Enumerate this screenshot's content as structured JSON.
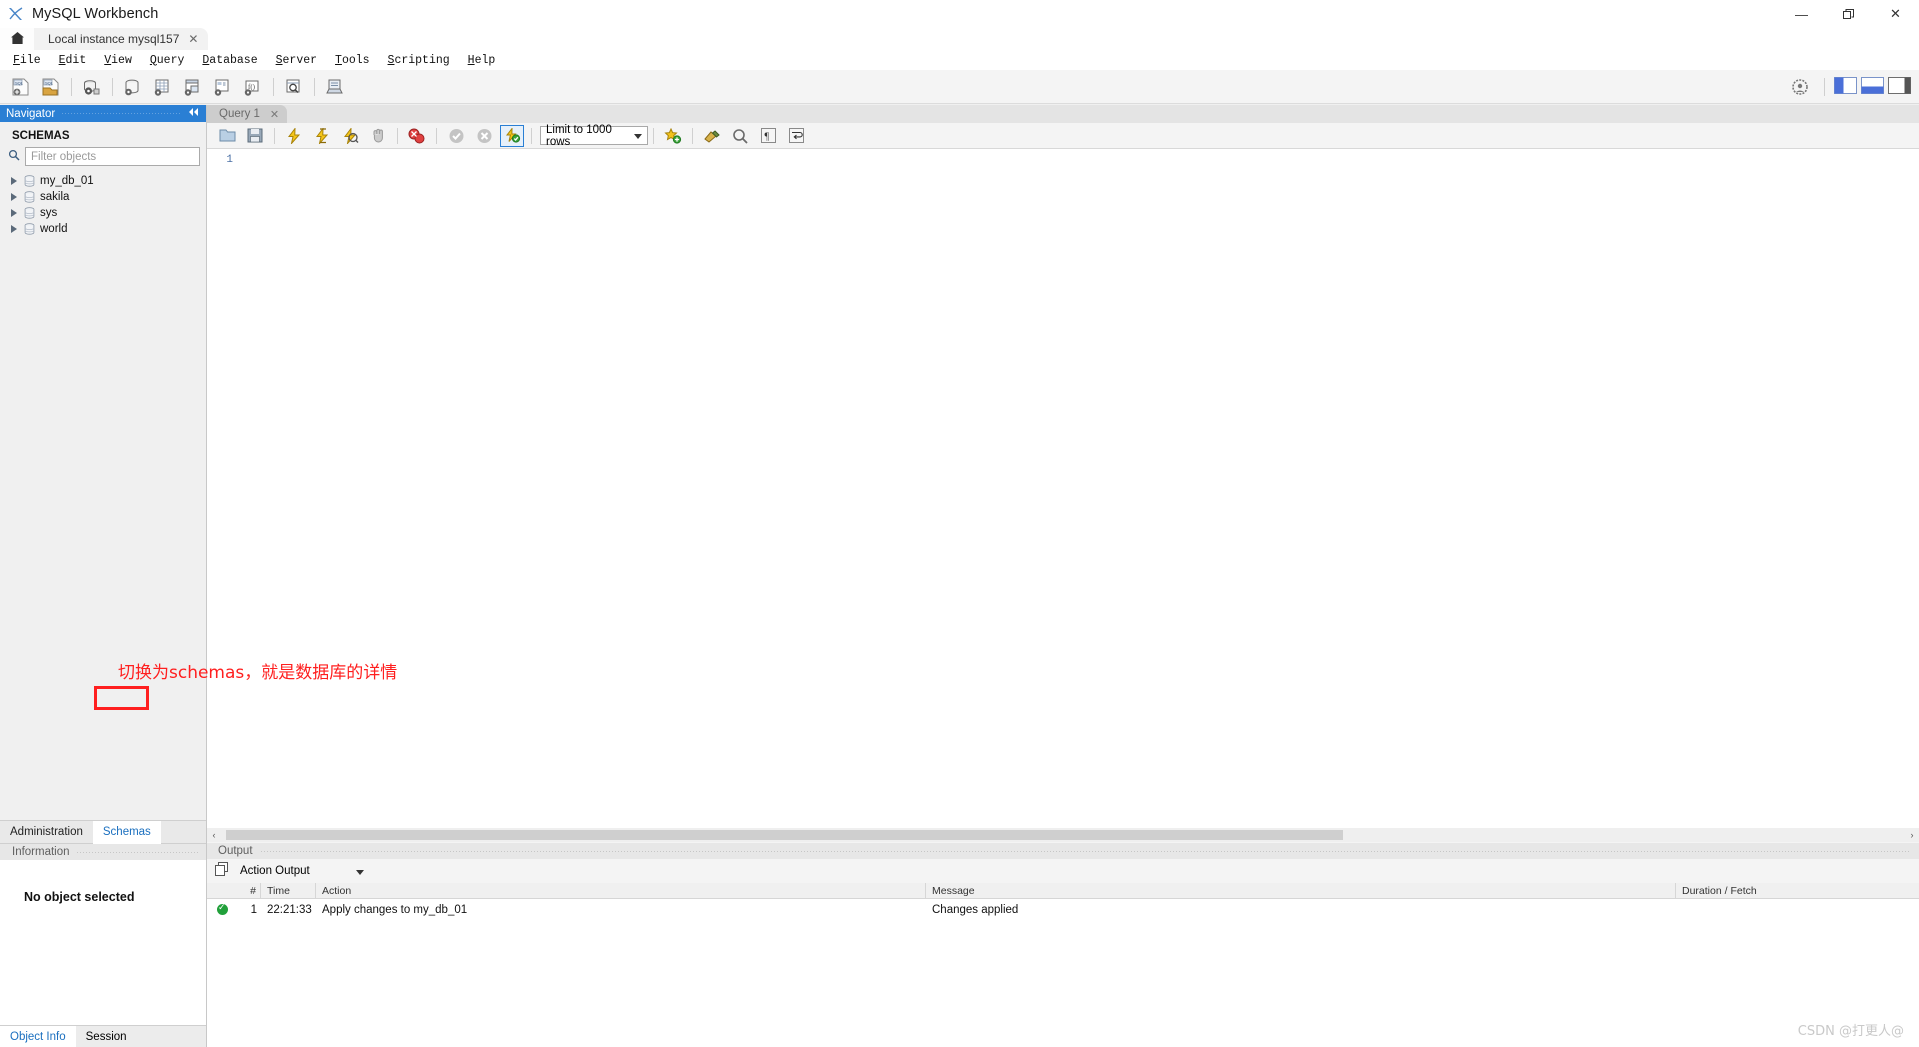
{
  "window": {
    "title": "MySQL Workbench",
    "minimize": "—",
    "maximize": "❐",
    "close": "✕"
  },
  "connection_tabs": {
    "home_icon": "home-icon",
    "active_tab": "Local instance mysql157",
    "close_glyph": "✕"
  },
  "menubar": {
    "items": [
      {
        "pre": "F",
        "rest": "ile"
      },
      {
        "pre": "E",
        "rest": "dit"
      },
      {
        "pre": "V",
        "rest": "iew"
      },
      {
        "pre": "Q",
        "rest": "uery"
      },
      {
        "pre": "D",
        "rest": "atabase"
      },
      {
        "pre": "S",
        "rest": "erver"
      },
      {
        "pre": "T",
        "rest": "ools"
      },
      {
        "pre": "S",
        "rest": "cripting"
      },
      {
        "pre": "H",
        "rest": "elp"
      }
    ]
  },
  "main_toolbar": {
    "buttons": [
      "new-sql-tab-icon",
      "open-sql-script-icon",
      "new-connection-icon",
      "manage-connections-icon",
      "new-schema-icon",
      "new-table-icon",
      "new-view-icon",
      "new-procedure-icon",
      "new-function-icon",
      "search-data-icon",
      "reconnect-icon"
    ],
    "right_buttons": [
      "workbench-globe-icon",
      "toggle-sidebar-icon",
      "toggle-output-icon",
      "toggle-secondary-sidebar-icon"
    ]
  },
  "navigator": {
    "header_title": "Navigator",
    "collapse_icon": "collapse-icon",
    "section_label": "SCHEMAS",
    "search_icon": "search-icon",
    "filter_placeholder": "Filter objects",
    "filter_value": "",
    "schemas": [
      {
        "name": "my_db_01"
      },
      {
        "name": "sakila"
      },
      {
        "name": "sys"
      },
      {
        "name": "world"
      }
    ],
    "tabs": [
      {
        "label": "Administration",
        "selected": false
      },
      {
        "label": "Schemas",
        "selected": true
      }
    ],
    "information": {
      "header": "Information",
      "body_text": "No object selected"
    },
    "bottom_tabs": [
      {
        "label": "Object Info",
        "selected": true
      },
      {
        "label": "Session",
        "selected": false
      }
    ]
  },
  "editor": {
    "tab_label": "Query 1",
    "tab_close": "✕",
    "toolbar_buttons": [
      "open-file-icon",
      "save-file-icon",
      "execute-icon",
      "execute-current-statement-icon",
      "explain-icon",
      "stop-icon",
      "toggle-stop-on-error-icon",
      "commit-icon",
      "rollback-icon",
      "auto-commit-icon"
    ],
    "limit_label": "Limit to 1000 rows",
    "limit_dropdown_icon": "chevron-down-icon",
    "extra_buttons": [
      "snippets-icon",
      "beautify-sql-icon",
      "find-icon",
      "toggle-invisible-chars-icon",
      "wrap-lines-icon"
    ],
    "line_numbers": [
      "1"
    ],
    "sql_text": "",
    "hscroll_left": "‹",
    "hscroll_right": "›"
  },
  "output": {
    "header": "Output",
    "mode_icon": "output-mode-icon",
    "mode_value": "Action Output",
    "mode_dropdown_icon": "chevron-down-icon",
    "columns": [
      "#",
      "Time",
      "Action",
      "Message",
      "Duration / Fetch"
    ],
    "rows": [
      {
        "status": "success",
        "num": "1",
        "time": "22:21:33",
        "action": "Apply changes to my_db_01",
        "message": "Changes applied",
        "duration": ""
      }
    ]
  },
  "annotations": {
    "note_text": "切换为schemas，就是数据库的详情",
    "note_color": "#ff1f1f",
    "highlight_target": "Schemas"
  },
  "watermark": {
    "text": "CSDN @打更人@"
  }
}
